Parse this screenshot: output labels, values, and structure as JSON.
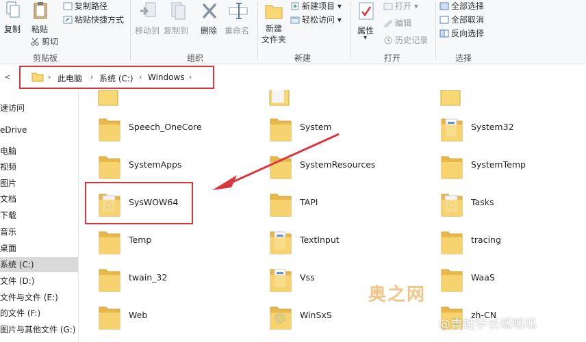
{
  "ribbon": {
    "clipboard": {
      "copy": "复制",
      "paste": "粘贴",
      "copy_path": "复制路径",
      "paste_shortcut": "粘贴快捷方式",
      "cut": "剪切",
      "group": "剪贴板"
    },
    "organize": {
      "move_to": "移动到",
      "copy_to": "复制到",
      "delete": "删除",
      "rename": "重命名",
      "group": "组织"
    },
    "new": {
      "new_folder": "新建\n文件夹",
      "new_item": "新建项目",
      "easy_access": "轻松访问",
      "group": "新建"
    },
    "open": {
      "properties": "属性",
      "open": "打开",
      "edit": "编辑",
      "history": "历史记录",
      "group": "打开"
    },
    "select": {
      "select_all": "全部选择",
      "select_none": "全部取消",
      "invert": "反向选择",
      "group": "选择"
    }
  },
  "address": {
    "back_arrow": "<",
    "crumbs": [
      "此电脑",
      "系统 (C:)",
      "Windows"
    ]
  },
  "nav": {
    "items": [
      {
        "label": "速访问",
        "selected": false
      },
      {
        "label": "eDrive",
        "selected": false
      },
      {
        "label": "电脑",
        "selected": false
      },
      {
        "label": "视频",
        "selected": false
      },
      {
        "label": "图片",
        "selected": false
      },
      {
        "label": "文档",
        "selected": false
      },
      {
        "label": "下载",
        "selected": false
      },
      {
        "label": "音乐",
        "selected": false
      },
      {
        "label": "桌面",
        "selected": false
      },
      {
        "label": "系统 (C:)",
        "selected": true
      },
      {
        "label": "文件 (D:)",
        "selected": false
      },
      {
        "label": "文件与文件 (E:)",
        "selected": false
      },
      {
        "label": "的文件 (F:)",
        "selected": false
      },
      {
        "label": "图片与其他文件 (G:)",
        "selected": false
      }
    ]
  },
  "folders": {
    "col1": [
      "Speech_OneCore",
      "SystemApps",
      "SysWOW64",
      "Temp",
      "twain_32",
      "Web"
    ],
    "col2": [
      "System",
      "SystemResources",
      "TAPI",
      "TextInput",
      "Vss",
      "WinSxS"
    ],
    "col3": [
      "System32",
      "SystemTemp",
      "Tasks",
      "tracing",
      "WaaS",
      "zh-CN"
    ]
  },
  "watermark": {
    "brand": "奥之网",
    "author": "@青蛙学长呱呱呱"
  },
  "colors": {
    "highlight": "#d9363e",
    "folder_yellow": "#f8d775",
    "folder_dark": "#e8b84a"
  }
}
